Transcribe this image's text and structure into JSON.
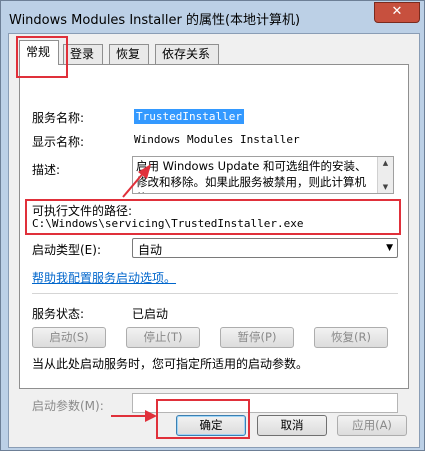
{
  "window": {
    "title": "Windows Modules Installer 的属性(本地计算机)",
    "close_glyph": "✕"
  },
  "tabs": [
    {
      "label": "常规"
    },
    {
      "label": "登录"
    },
    {
      "label": "恢复"
    },
    {
      "label": "依存关系"
    }
  ],
  "general": {
    "service_name_label": "服务名称:",
    "service_name_value": "TrustedInstaller",
    "display_name_label": "显示名称:",
    "display_name_value": "Windows Modules Installer",
    "description_label": "描述:",
    "description_value": "启用 Windows Update 和可选组件的安装、修改和移除。如果此服务被禁用，则此计算机的",
    "exe_path_label": "可执行文件的路径:",
    "exe_path_value": "C:\\Windows\\servicing\\TrustedInstaller.exe",
    "startup_type_label": "启动类型(E):",
    "startup_type_value": "自动",
    "help_link": "帮助我配置服务启动选项。",
    "status_label": "服务状态:",
    "status_value": "已启动",
    "start_button": "启动(S)",
    "stop_button": "停止(T)",
    "pause_button": "暂停(P)",
    "resume_button": "恢复(R)",
    "param_hint": "当从此处启动服务时，您可指定所适用的启动参数。",
    "param_label": "启动参数(M):",
    "param_value": ""
  },
  "footer": {
    "ok_button": "确定",
    "cancel_button": "取消",
    "apply_button": "应用(A)"
  },
  "annotation_color": "#e0303a",
  "icons": {
    "dropdown": "chevron-down-icon",
    "scroll_up": "scroll-up-icon",
    "scroll_down": "scroll-down-icon"
  }
}
